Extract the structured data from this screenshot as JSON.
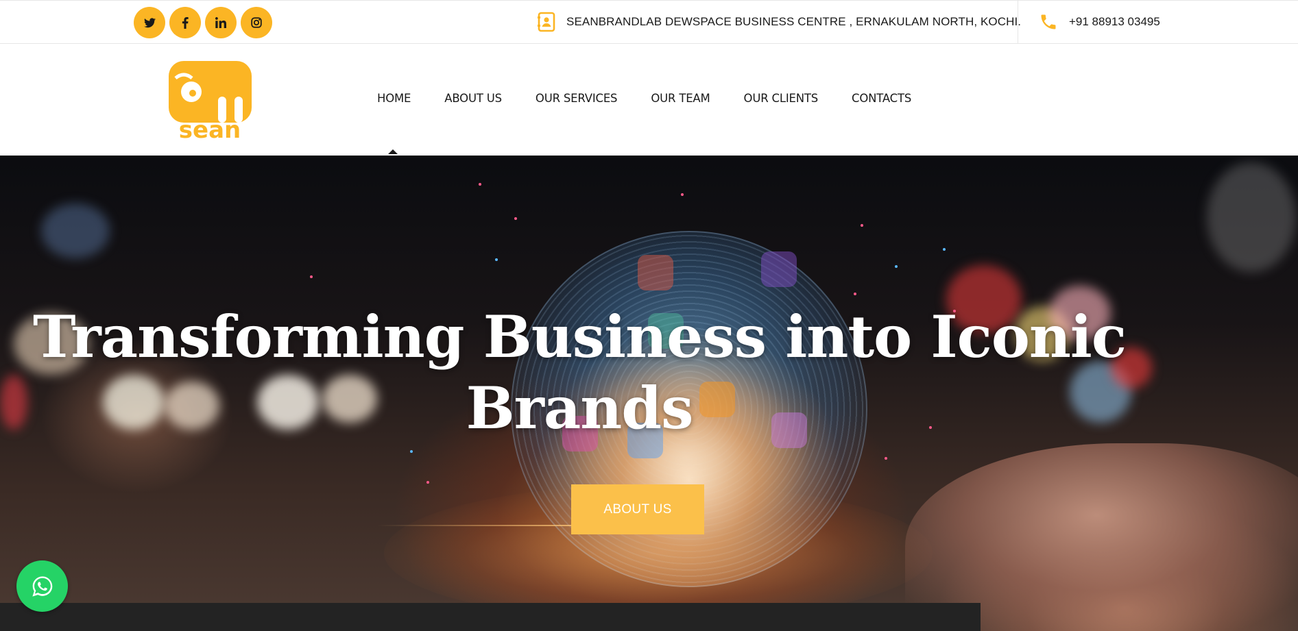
{
  "topbar": {
    "social": [
      {
        "icon": "twitter-icon"
      },
      {
        "icon": "facebook-icon"
      },
      {
        "icon": "linkedin-icon"
      },
      {
        "icon": "instagram-icon"
      }
    ],
    "address": "SEANBRANDLAB DEWSPACE BUSINESS CENTRE , ERNAKULAM NORTH, KOCHI.",
    "phone": "+91 88913 03495"
  },
  "header": {
    "logo_text": "sean",
    "nav": [
      "HOME",
      "ABOUT US",
      "OUR SERVICES",
      "OUR TEAM",
      "OUR CLIENTS",
      "CONTACTS"
    ],
    "active": "HOME"
  },
  "hero": {
    "title_line1": "Transforming Business into Iconic",
    "title_line2": "Brands",
    "button": "ABOUT US"
  },
  "colors": {
    "accent": "#fbb524",
    "button": "#fbc04a",
    "whatsapp": "#25d366"
  }
}
